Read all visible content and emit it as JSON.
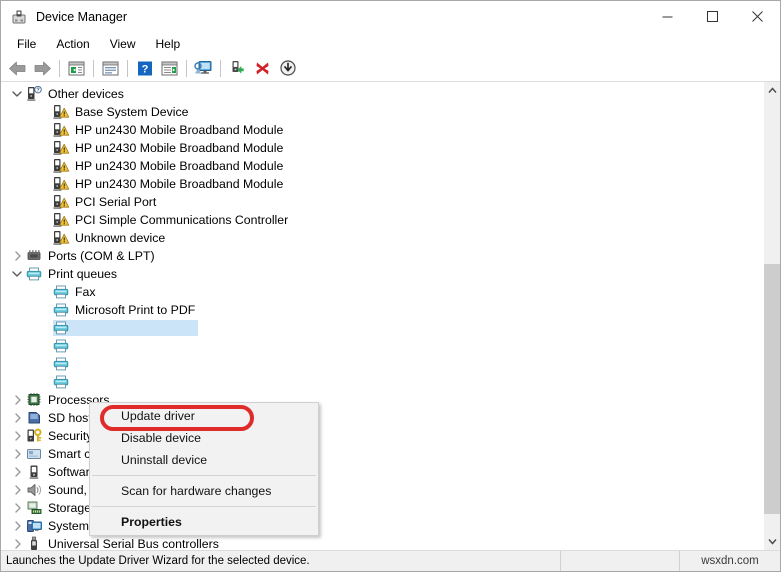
{
  "window": {
    "title": "Device Manager",
    "icon": "device-manager-icon",
    "controls": [
      {
        "name": "minimize-button",
        "glyph": "minimize"
      },
      {
        "name": "maximize-button",
        "glyph": "maximize"
      },
      {
        "name": "close-button",
        "glyph": "close"
      }
    ]
  },
  "menubar": {
    "items": [
      {
        "label": "File"
      },
      {
        "label": "Action"
      },
      {
        "label": "View"
      },
      {
        "label": "Help"
      }
    ]
  },
  "toolbar": {
    "buttons": [
      {
        "name": "back-button",
        "icon": "back-arrow-icon"
      },
      {
        "name": "forward-button",
        "icon": "forward-arrow-icon"
      },
      {
        "name": "separator-1",
        "icon": "separator"
      },
      {
        "name": "show-hide-console-tree-button",
        "icon": "console-tree-icon"
      },
      {
        "name": "separator-2",
        "icon": "separator"
      },
      {
        "name": "properties-button",
        "icon": "properties-icon"
      },
      {
        "name": "separator-3",
        "icon": "separator"
      },
      {
        "name": "help-button",
        "icon": "help-question-icon"
      },
      {
        "name": "show-hide-action-pane-button",
        "icon": "action-pane-icon"
      },
      {
        "name": "separator-4",
        "icon": "separator"
      },
      {
        "name": "scan-for-hardware-changes-button",
        "icon": "scan-monitor-icon"
      },
      {
        "name": "separator-5",
        "icon": "separator"
      },
      {
        "name": "update-driver-button",
        "icon": "update-driver-icon"
      },
      {
        "name": "uninstall-device-button",
        "icon": "red-x-icon"
      },
      {
        "name": "disable-device-button",
        "icon": "down-arrow-circle-icon"
      }
    ]
  },
  "tree": {
    "nodes": [
      {
        "label": "Other devices",
        "level": 1,
        "icon": "unknown-device-icon",
        "expander": "expanded",
        "selected": false
      },
      {
        "label": "Base System Device",
        "level": 2,
        "icon": "warning-device-icon",
        "expander": "none",
        "selected": false
      },
      {
        "label": "HP un2430 Mobile Broadband Module",
        "level": 2,
        "icon": "warning-device-icon",
        "expander": "none",
        "selected": false
      },
      {
        "label": "HP un2430 Mobile Broadband Module",
        "level": 2,
        "icon": "warning-device-icon",
        "expander": "none",
        "selected": false
      },
      {
        "label": "HP un2430 Mobile Broadband Module",
        "level": 2,
        "icon": "warning-device-icon",
        "expander": "none",
        "selected": false
      },
      {
        "label": "HP un2430 Mobile Broadband Module",
        "level": 2,
        "icon": "warning-device-icon",
        "expander": "none",
        "selected": false
      },
      {
        "label": "PCI Serial Port",
        "level": 2,
        "icon": "warning-device-icon",
        "expander": "none",
        "selected": false
      },
      {
        "label": "PCI Simple Communications Controller",
        "level": 2,
        "icon": "warning-device-icon",
        "expander": "none",
        "selected": false
      },
      {
        "label": "Unknown device",
        "level": 2,
        "icon": "warning-device-icon",
        "expander": "none",
        "selected": false
      },
      {
        "label": "Ports (COM & LPT)",
        "level": 1,
        "icon": "ports-icon",
        "expander": "collapsed",
        "selected": false
      },
      {
        "label": "Print queues",
        "level": 1,
        "icon": "printer-icon",
        "expander": "expanded",
        "selected": false
      },
      {
        "label": "Fax",
        "level": 2,
        "icon": "printer-icon",
        "expander": "none",
        "selected": false
      },
      {
        "label": "Microsoft Print to PDF",
        "level": 2,
        "icon": "printer-icon",
        "expander": "none",
        "selected": false
      },
      {
        "label": "",
        "level": 2,
        "icon": "printer-icon",
        "expander": "none",
        "selected": true
      },
      {
        "label": "",
        "level": 2,
        "icon": "printer-icon",
        "expander": "none",
        "selected": false
      },
      {
        "label": "",
        "level": 2,
        "icon": "printer-icon",
        "expander": "none",
        "selected": false
      },
      {
        "label": "",
        "level": 2,
        "icon": "printer-icon",
        "expander": "none",
        "selected": false
      },
      {
        "label": "Processors",
        "level": 1,
        "icon": "processor-icon",
        "expander": "collapsed",
        "selected": false
      },
      {
        "label": "SD host adapters",
        "level": 1,
        "icon": "sd-host-icon",
        "expander": "collapsed",
        "selected": false
      },
      {
        "label": "Security devices",
        "level": 1,
        "icon": "security-device-icon",
        "expander": "collapsed",
        "selected": false
      },
      {
        "label": "Smart card readers",
        "level": 1,
        "icon": "smartcard-icon",
        "expander": "collapsed",
        "selected": false
      },
      {
        "label": "Software devices",
        "level": 1,
        "icon": "software-device-icon",
        "expander": "collapsed",
        "selected": false
      },
      {
        "label": "Sound, video and game controllers",
        "level": 1,
        "icon": "sound-icon",
        "expander": "collapsed",
        "selected": false
      },
      {
        "label": "Storage controllers",
        "level": 1,
        "icon": "storage-controller-icon",
        "expander": "collapsed",
        "selected": false
      },
      {
        "label": "System devices",
        "level": 1,
        "icon": "system-device-icon",
        "expander": "collapsed",
        "selected": false
      },
      {
        "label": "Universal Serial Bus controllers",
        "level": 1,
        "icon": "usb-icon",
        "expander": "collapsed",
        "selected": false
      }
    ]
  },
  "context_menu": {
    "items": [
      {
        "label": "Update driver",
        "type": "item",
        "bold": false,
        "highlighted": true
      },
      {
        "label": "Disable device",
        "type": "item",
        "bold": false,
        "highlighted": false
      },
      {
        "label": "Uninstall device",
        "type": "item",
        "bold": false,
        "highlighted": false
      },
      {
        "label": "",
        "type": "separator",
        "bold": false,
        "highlighted": false
      },
      {
        "label": "Scan for hardware changes",
        "type": "item",
        "bold": false,
        "highlighted": false
      },
      {
        "label": "",
        "type": "separator",
        "bold": false,
        "highlighted": false
      },
      {
        "label": "Properties",
        "type": "item",
        "bold": true,
        "highlighted": false
      }
    ],
    "highlight_color": "#e02b2b"
  },
  "statusbar": {
    "message": "Launches the Update Driver Wizard for the selected device.",
    "middle": "",
    "watermark": "wsxdn.com"
  },
  "scrollbar": {
    "up_arrow": "chevron-up-icon",
    "down_arrow": "chevron-down-icon"
  }
}
